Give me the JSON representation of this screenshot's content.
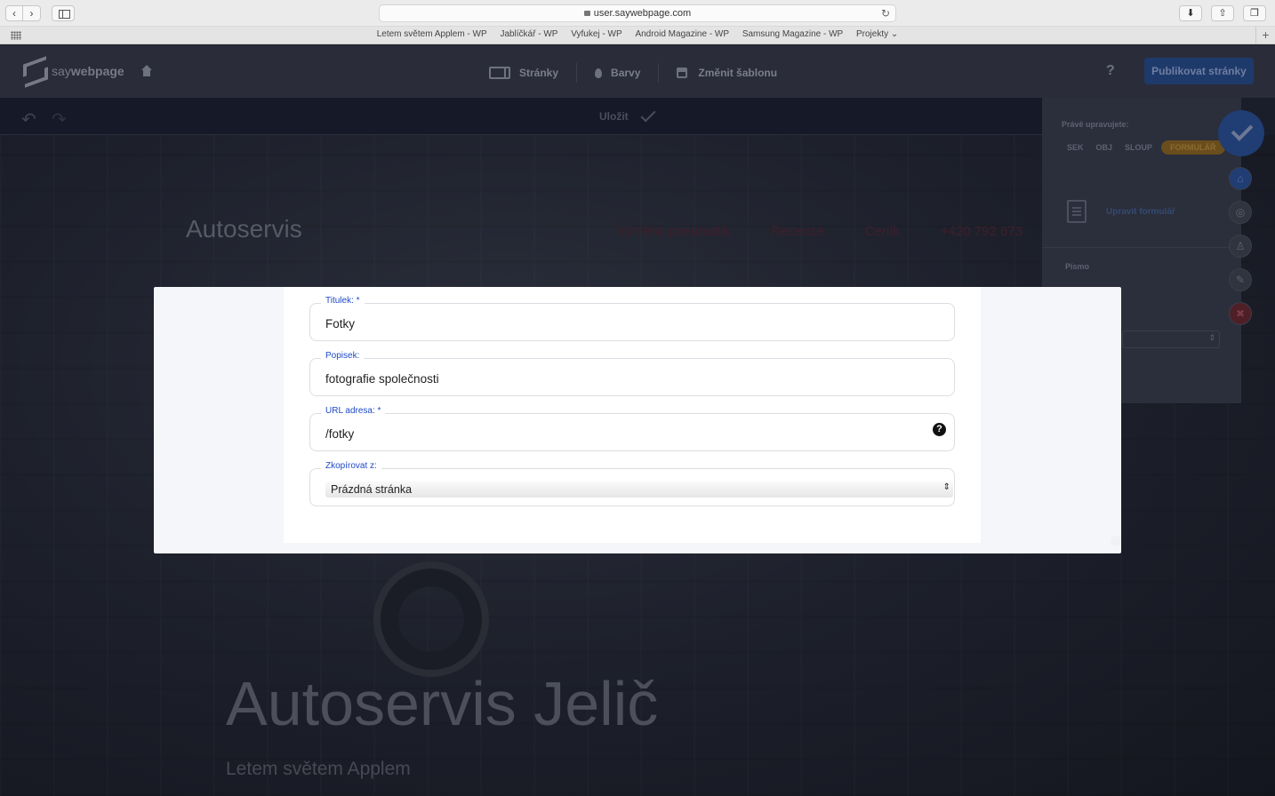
{
  "browser": {
    "url": "user.saywebpage.com",
    "bookmarks": [
      "Letem světem Applem - WP",
      "Jablíčkář - WP",
      "Vyfukej - WP",
      "Android Magazine - WP",
      "Samsung Magazine - WP",
      "Projekty ⌄"
    ]
  },
  "app": {
    "logo_prefix": "say",
    "logo_bold": "webpage",
    "nav": {
      "pages": "Stránky",
      "colors": "Barvy",
      "template": "Změnit šablonu"
    },
    "help": "?",
    "publish_label": "Publikovat stránky",
    "save_label": "Uložit"
  },
  "side_panel": {
    "title": "Právě upravujete:",
    "tabs": [
      "SEK",
      "OBJ",
      "SLOUP",
      "FORMULÁŘ"
    ],
    "edit_form": "Upravit formulář",
    "font_label": "Písmo"
  },
  "background_site": {
    "brand": "Autoservis",
    "nav": [
      "Výměna pneumatik",
      "Recenze",
      "Ceník",
      "+420 792 673"
    ],
    "hero_title": "Autoservis Jelič",
    "hero_subtitle": "Letem světem Applem"
  },
  "modal": {
    "title_field": {
      "label": "Titulek: *",
      "value": "Fotky"
    },
    "description_field": {
      "label": "Popisek:",
      "value": "fotografie společnosti"
    },
    "url_field": {
      "label": "URL adresa: *",
      "value": "/fotky"
    },
    "copy_field": {
      "label": "Zkopírovat z:",
      "value": "Prázdná stránka"
    }
  }
}
